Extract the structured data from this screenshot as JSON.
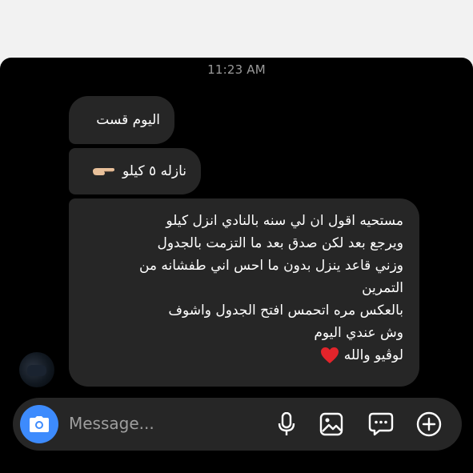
{
  "timestamp": "11:23 AM",
  "messages": [
    {
      "text": "اليوم قست"
    },
    {
      "text": "نازله ٥ كيلو",
      "emoji": "hand-pointing-icon"
    },
    {
      "lines": [
        "مستحيه اقول ان لي سنه بالنادي انزل كيلو",
        "ويرجع بعد لكن صدق بعد ما التزمت بالجدول",
        "وزني قاعد ينزل بدون ما احس اني طفشانه من",
        "التمرين",
        "بالعكس مره اتحمس افتح الجدول واشوف",
        "وش عندي اليوم",
        "لوڤيو والله"
      ],
      "emoji": "red-heart-icon"
    }
  ],
  "composer": {
    "placeholder": "Message...",
    "icons": [
      "camera-icon",
      "microphone-icon",
      "gallery-icon",
      "sticker-icon",
      "plus-icon"
    ],
    "accent": "#3d8bfd"
  },
  "colors": {
    "background": "#000000",
    "bubble": "#262626",
    "text": "#ffffff",
    "muted": "#9a9a9a"
  }
}
